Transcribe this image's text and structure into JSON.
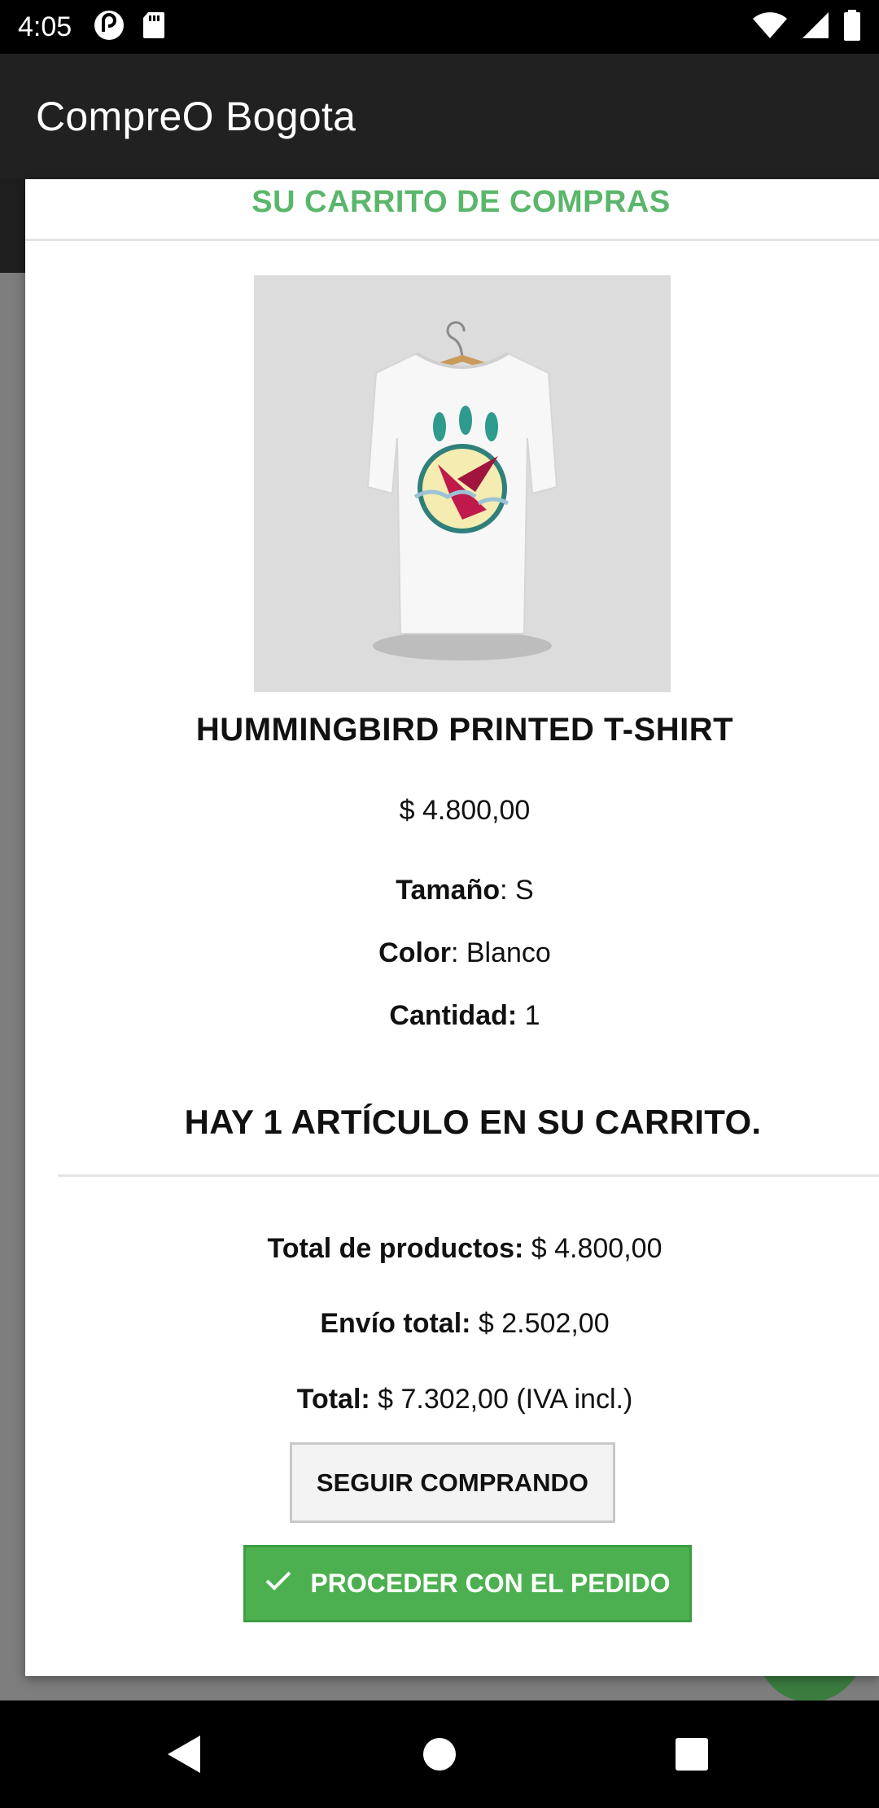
{
  "status_bar": {
    "time": "4:05",
    "left_icons": [
      "pocket-casts-icon",
      "sd-card-icon"
    ],
    "right_icons": [
      "wifi-icon",
      "cell-signal-icon",
      "battery-icon"
    ]
  },
  "app_bar": {
    "title": "CompreO Bogota"
  },
  "cart_modal": {
    "title": "SU CARRITO DE COMPRAS",
    "product": {
      "image_icon": "tshirt-product-image",
      "name": "HUMMINGBIRD PRINTED T-SHIRT",
      "price": "$ 4.800,00",
      "size_label": "Tamaño",
      "size_value": ": S",
      "color_label": "Color",
      "color_value": ": Blanco",
      "quantity_label": "Cantidad:",
      "quantity_value": " 1"
    },
    "cart_count_text": "HAY 1 ARTÍCULO EN SU CARRITO.",
    "summary": {
      "products_label": "Total de productos:",
      "products_value": " $ 4.800,00",
      "shipping_label": "Envío total:",
      "shipping_value": " $ 2.502,00",
      "total_label": "Total:",
      "total_value": " $ 7.302,00 (IVA incl.)"
    },
    "continue_button": "SEGUIR COMPRANDO",
    "proceed_button": "PROCEDER CON EL PEDIDO"
  },
  "colors": {
    "title_green": "#5ab66a",
    "proceed_green": "#4cb050",
    "app_bar": "#212121"
  },
  "nav_bar": {
    "icons": [
      "back-icon",
      "home-icon",
      "recents-icon"
    ]
  }
}
